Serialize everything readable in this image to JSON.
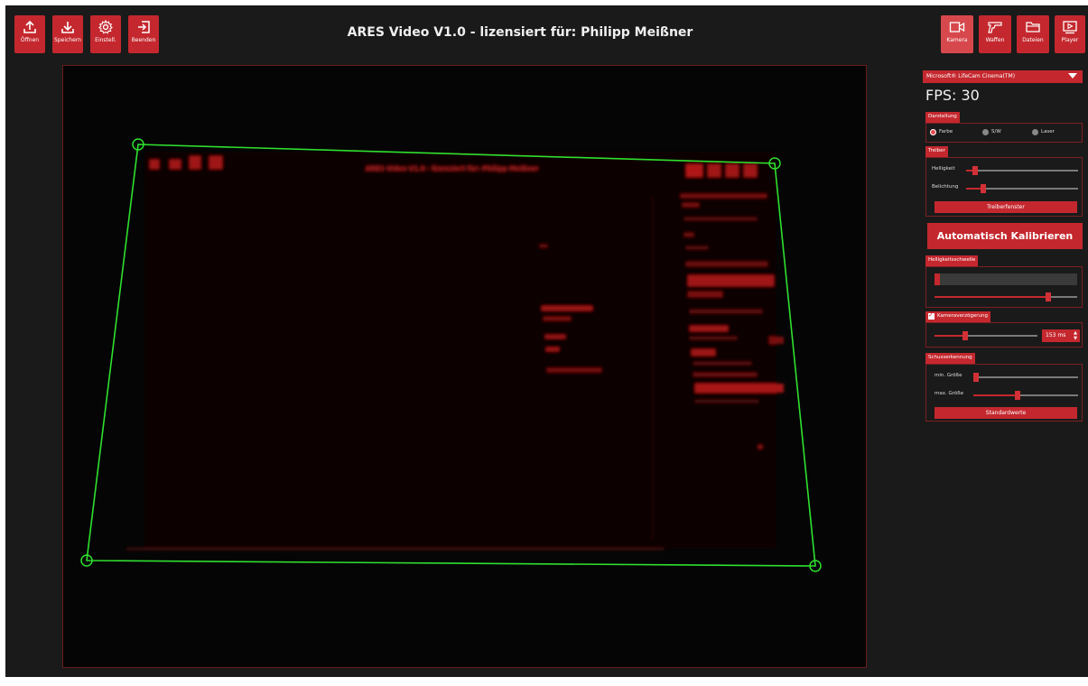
{
  "app": {
    "title": "ARES Video V1.0 - lizensiert für: Philipp Meißner",
    "accent": "#c4282e",
    "overlay_color": "#2fe02f"
  },
  "toolbar_left": [
    {
      "label": "Öffnen",
      "icon": "upload-icon"
    },
    {
      "label": "Speichern",
      "icon": "download-icon"
    },
    {
      "label": "Einstell.",
      "icon": "gear-icon"
    },
    {
      "label": "Beenden",
      "icon": "exit-icon"
    }
  ],
  "toolbar_right": [
    {
      "label": "Kamera",
      "icon": "camera-icon",
      "active": true
    },
    {
      "label": "Waffen",
      "icon": "gun-icon",
      "active": false
    },
    {
      "label": "Dateien",
      "icon": "folder-icon",
      "active": false
    },
    {
      "label": "Player",
      "icon": "player-icon",
      "active": false
    }
  ],
  "panel": {
    "camera_select": "Microsoft® LifeCam Cinema(TM)",
    "fps": "FPS: 30",
    "darstellung": {
      "title": "Darstellung",
      "options": [
        "Farbe",
        "S/W",
        "Laser"
      ],
      "selected": "Farbe"
    },
    "treiber": {
      "title": "Treiber",
      "helligkeit_label": "Helligkeit",
      "helligkeit_value": 0.08,
      "belichtung_label": "Belichtung",
      "belichtung_value": 0.15,
      "button": "Treiberfenster"
    },
    "calibrate_button": "Automatisch Kalibrieren",
    "helligkeitsschwelle": {
      "title": "Helligkeitsschwelle",
      "level": 0.04,
      "slider_value": 0.8
    },
    "kameraverzoegerung": {
      "title": "Kameraverzögerung",
      "checked": true,
      "slider_value": 0.3,
      "value": "153 ms"
    },
    "schusserkennung": {
      "title": "Schusserkennung",
      "min_label": "min. Größe",
      "min_value": 0.0,
      "max_label": "max. Größe",
      "max_value": 0.42,
      "button": "Standardwerte"
    }
  },
  "video": {
    "overlay_text": "ARES Video V1.0 - lizensiert für: Philipp Meißner"
  }
}
